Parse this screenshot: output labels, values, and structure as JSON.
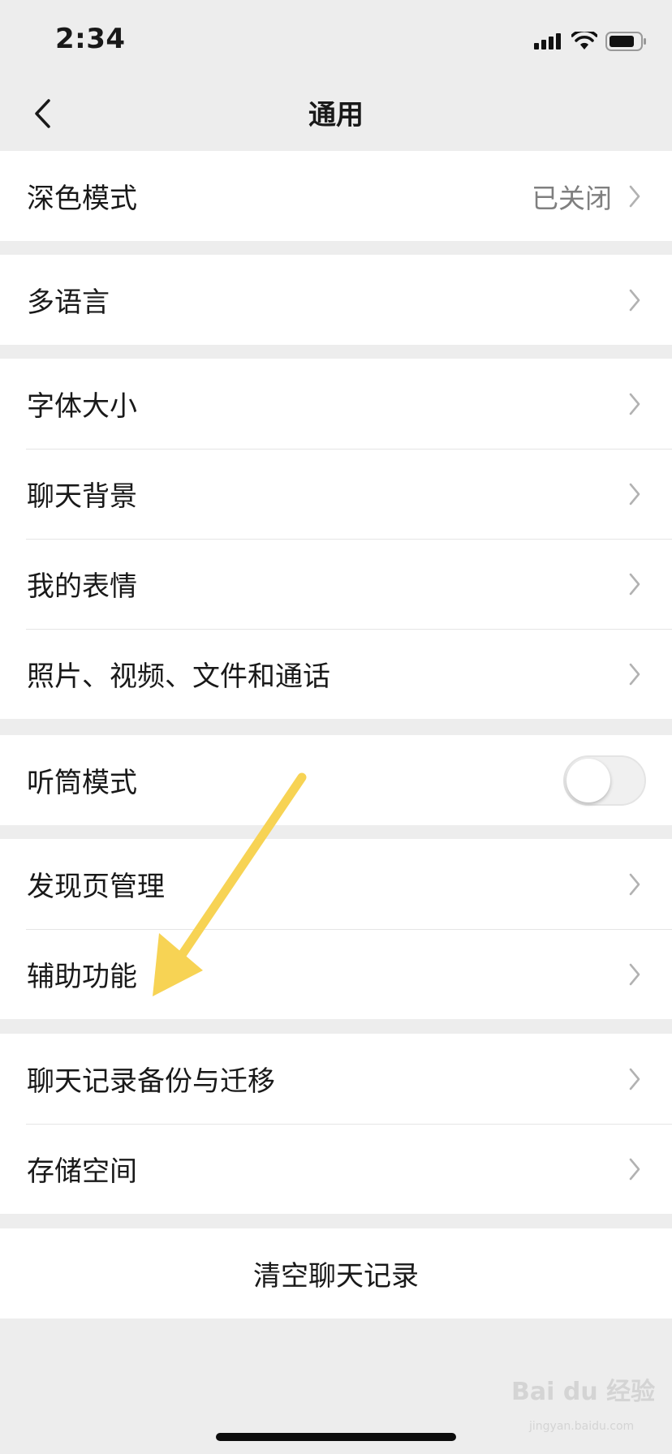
{
  "status_bar": {
    "time": "2:34"
  },
  "nav": {
    "title": "通用"
  },
  "groups": [
    {
      "items": [
        {
          "label": "深色模式",
          "value": "已关闭"
        }
      ]
    },
    {
      "items": [
        {
          "label": "多语言"
        }
      ]
    },
    {
      "items": [
        {
          "label": "字体大小"
        },
        {
          "label": "聊天背景"
        },
        {
          "label": "我的表情"
        },
        {
          "label": "照片、视频、文件和通话"
        }
      ]
    },
    {
      "items": [
        {
          "label": "听筒模式",
          "toggle": false
        }
      ]
    },
    {
      "items": [
        {
          "label": "发现页管理"
        },
        {
          "label": "辅助功能"
        }
      ]
    },
    {
      "items": [
        {
          "label": "聊天记录备份与迁移"
        },
        {
          "label": "存储空间"
        }
      ]
    }
  ],
  "clear_history": {
    "label": "清空聊天记录"
  },
  "watermark": {
    "brand": "Bai du 经验",
    "url": "jingyan.baidu.com"
  },
  "colors": {
    "annotation_arrow": "#f7d354",
    "background": "#ededed",
    "separator": "#e5e5e5"
  },
  "icons": {
    "back": "chevron-left-icon",
    "row": "chevron-right-icon",
    "signal": "signal-icon",
    "wifi": "wifi-icon",
    "battery": "battery-icon"
  }
}
